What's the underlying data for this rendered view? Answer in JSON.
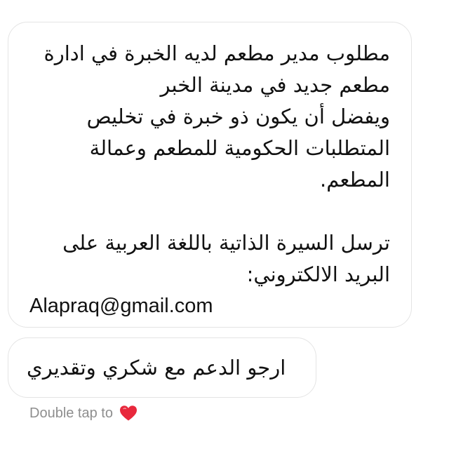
{
  "thread": {
    "messages": [
      {
        "lines": [
          "مطلوب مدير مطعم لديه الخبرة  في ادارة",
          "مطعم جديد   في مدينة الخبر",
          "ويفضل أن يكون ذو خبرة  في تخليص",
          "المتطلبات الحكومية للمطعم وعمالة",
          "المطعم.",
          "",
          "ترسل السيرة الذاتية باللغة العربية على",
          "البريد الالكتروني:"
        ],
        "email": "Alapraq@gmail.com"
      },
      {
        "lines": [
          "ارجو الدعم مع شكري وتقديري"
        ]
      }
    ],
    "reaction_hint": {
      "text": "Double tap to",
      "icon": "heart-icon",
      "icon_color": "#e8283c"
    }
  }
}
